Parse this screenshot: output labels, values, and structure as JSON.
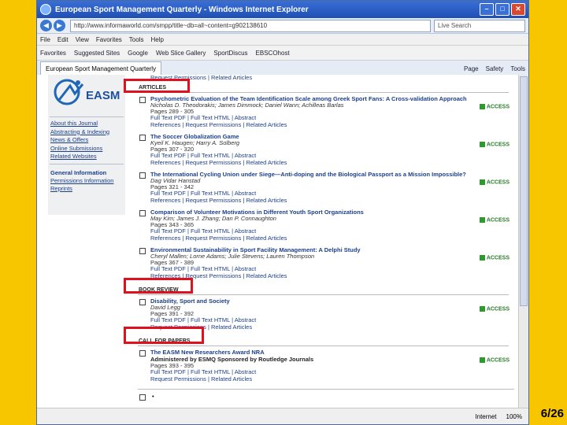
{
  "window": {
    "title": "European Sport Management Quarterly - Windows Internet Explorer",
    "url": "http://www.informaworld.com/smpp/title~db=all~content=g902138610",
    "search_placeholder": "Live Search"
  },
  "menu": [
    "File",
    "Edit",
    "View",
    "Favorites",
    "Tools",
    "Help"
  ],
  "links_bar": [
    "Favorites",
    "Suggested Sites",
    "Google",
    "Web Slice Gallery",
    "SportDiscus",
    "EBSCOhost"
  ],
  "tab": {
    "label": "European Sport Management Quarterly"
  },
  "tools": [
    "Page",
    "Safety",
    "Tools"
  ],
  "sidebar": {
    "logo_text": "EASM",
    "about_title": "About this Journal",
    "links": [
      "Abstracting & Indexing",
      "News & Offers",
      "Online Submissions",
      "Related Websites"
    ],
    "general_title": "General Information",
    "general_links": [
      "Permissions Information",
      "Reprints"
    ]
  },
  "top_links": "Request Permissions | Related Articles",
  "sections": {
    "articles": "ARTICLES",
    "book_review": "BOOK REVIEW",
    "call_for_papers": "CALL FOR PAPERS"
  },
  "articles": [
    {
      "title": "Psychometric Evaluation of the Team Identification Scale among Greek Sport Fans: A Cross-validation Approach",
      "authors": "Nicholas D. Theodorakis; James Dimmock; Daniel Wann; Achilleas Barlas",
      "pages": "Pages 289 - 305",
      "links1": "Full Text PDF | Full Text HTML | Abstract",
      "links2": "References | Request Permissions | Related Articles",
      "access": "ACCESS"
    },
    {
      "title": "The Soccer Globalization Game",
      "authors": "Kyeil K. Haugen; Harry A. Solberg",
      "pages": "Pages 307 - 320",
      "links1": "Full Text PDF | Full Text HTML | Abstract",
      "links2": "References | Request Permissions | Related Articles",
      "access": "ACCESS"
    },
    {
      "title": "The International Cycling Union under Siege—Anti-doping and the Biological Passport as a Mission Impossible?",
      "authors": "Dag Vidar Hanstad",
      "pages": "Pages 321 - 342",
      "links1": "Full Text PDF | Full Text HTML | Abstract",
      "links2": "References | Request Permissions | Related Articles",
      "access": "ACCESS"
    },
    {
      "title": "Comparison of Volunteer Motivations in Different Youth Sport Organizations",
      "authors": "May Kim; James J. Zhang; Dan P. Connaughton",
      "pages": "Pages 343 - 365",
      "links1": "Full Text PDF | Full Text HTML | Abstract",
      "links2": "References | Request Permissions | Related Articles",
      "access": "ACCESS"
    },
    {
      "title": "Environmental Sustainability in Sport Facility Management: A Delphi Study",
      "authors": "Cheryl Mallen; Lorne Adams; Julie Stevens; Lauren Thompson",
      "pages": "Pages 367 - 389",
      "links1": "Full Text PDF | Full Text HTML | Abstract",
      "links2": "References | Request Permissions | Related Articles",
      "access": "ACCESS"
    }
  ],
  "book_review": {
    "title": "Disability, Sport and Society",
    "authors": "David Legg",
    "pages": "Pages 391 - 392",
    "links1": "Full Text PDF | Full Text HTML | Abstract",
    "links2": "Request Permissions | Related Articles",
    "access": "ACCESS"
  },
  "call_for_papers": {
    "title": "The EASM New Researchers Award NRA",
    "subtitle": "Administered by ESMQ Sponsored by Routledge Journals",
    "pages": "Pages 393 - 395",
    "links1": "Full Text PDF | Full Text HTML | Abstract",
    "links2": "Request Permissions | Related Articles",
    "access": "ACCESS"
  },
  "status": {
    "zone": "Internet",
    "zoom": "100%"
  },
  "slide_number": "6/26"
}
